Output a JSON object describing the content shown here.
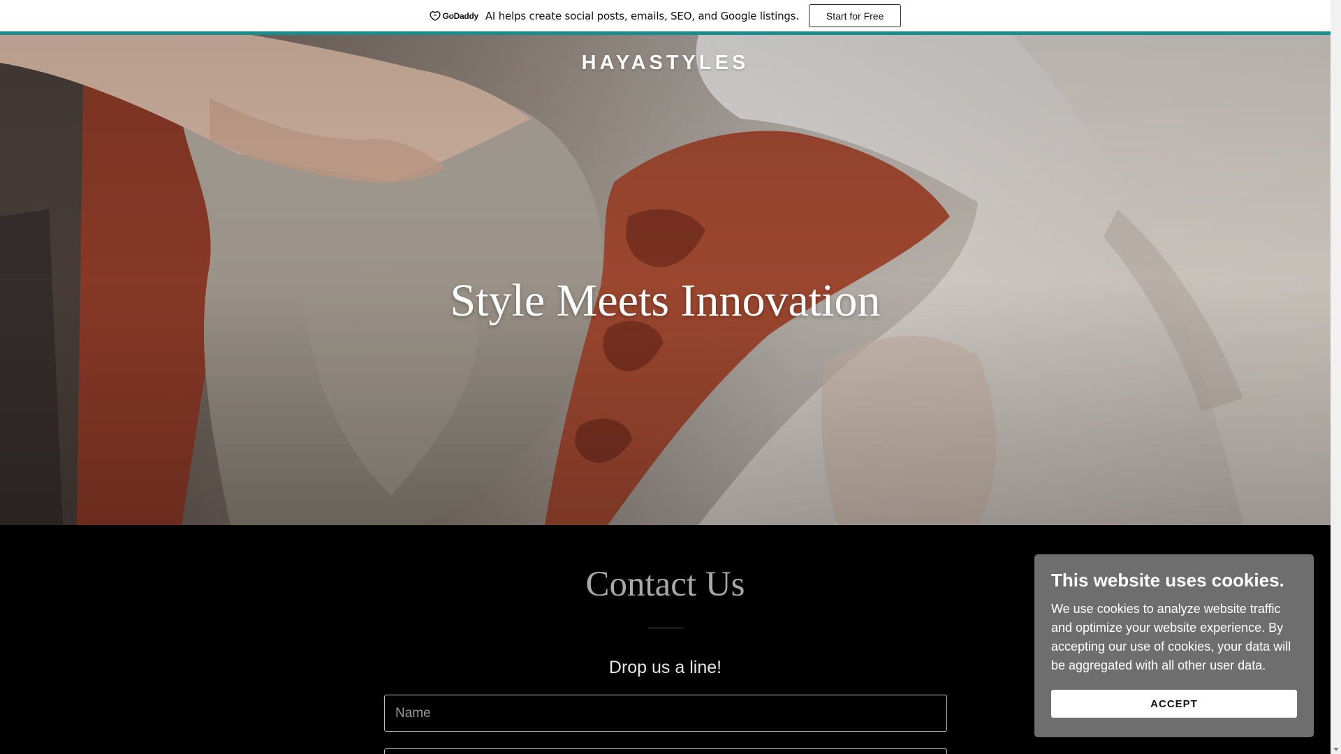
{
  "promo": {
    "logo_text": "GoDaddy",
    "message": "AI helps create social posts, emails, SEO, and Google listings.",
    "cta_label": "Start for Free",
    "accent_color": "#1c8b8e"
  },
  "hero": {
    "site_title": "HAYASTYLES",
    "headline": "Style Meets Innovation"
  },
  "contact": {
    "title": "Contact Us",
    "subtitle": "Drop us a line!",
    "name_placeholder": "Name",
    "email_placeholder": ""
  },
  "cookie_banner": {
    "title": "This website uses cookies.",
    "body": "We use cookies to analyze website traffic and optimize your website experience. By accepting our use of cookies, your data will be aggregated with all other user data.",
    "accept_label": "ACCEPT"
  }
}
